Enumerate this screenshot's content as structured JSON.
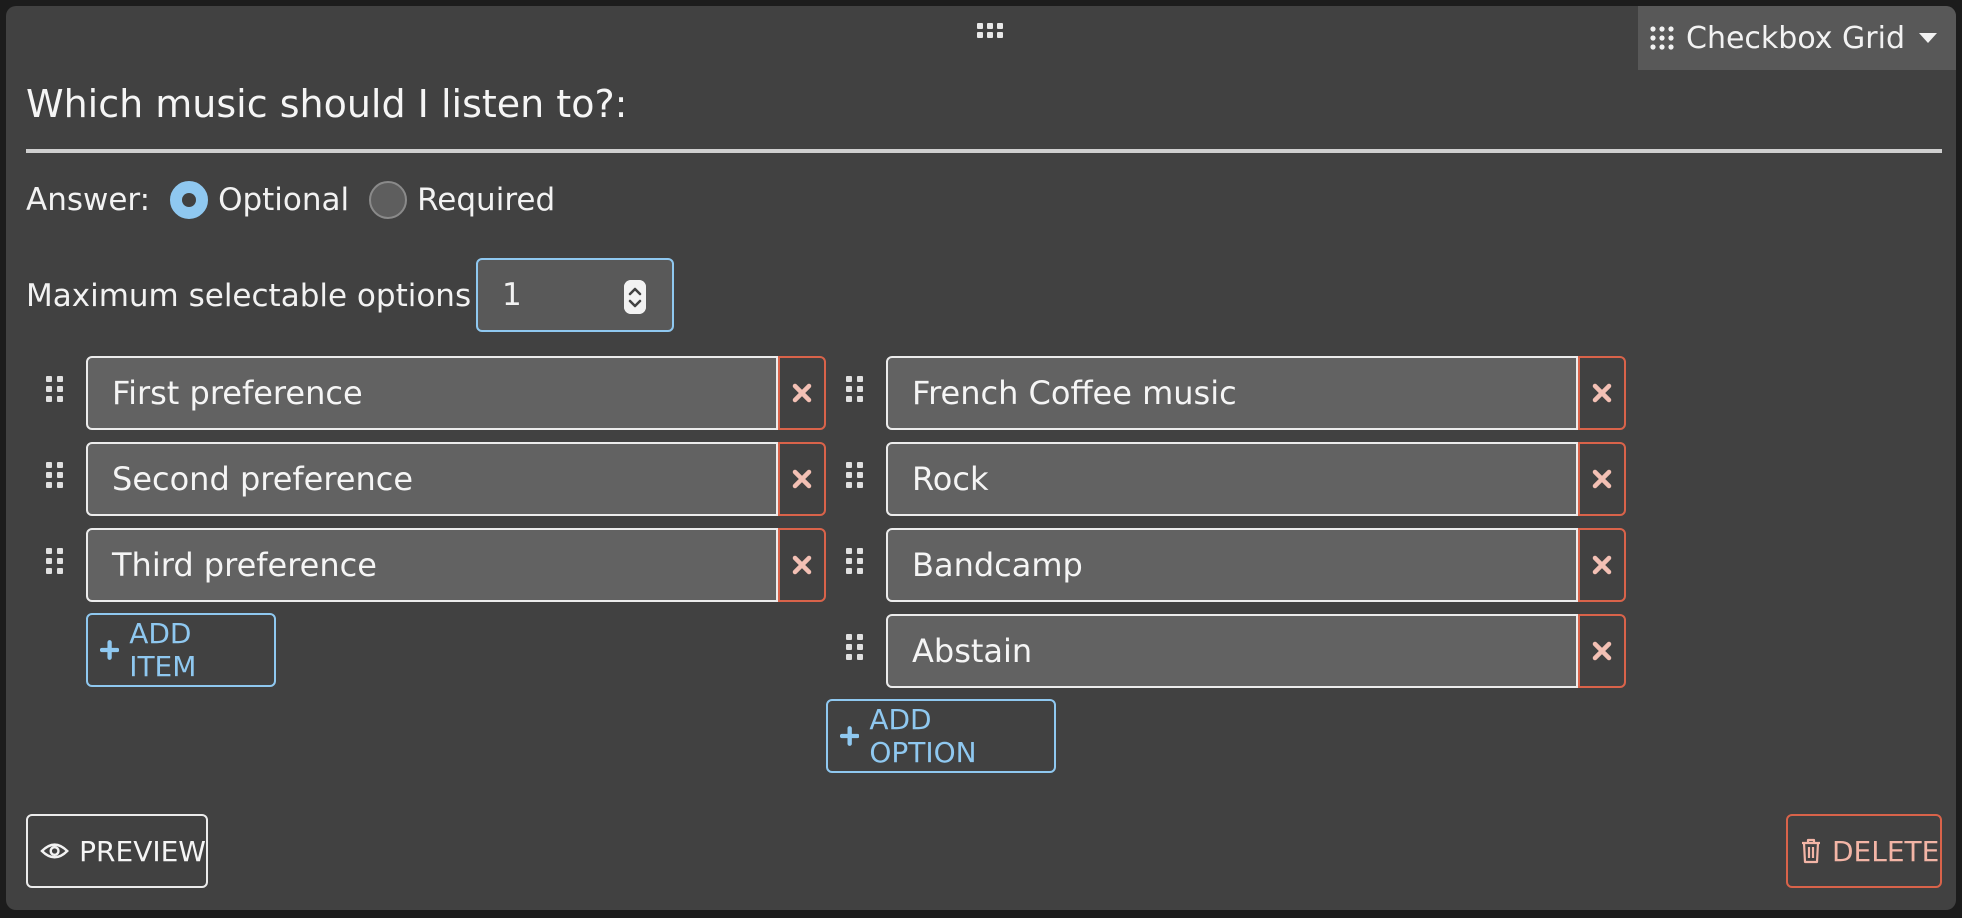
{
  "header": {
    "type_menu_label": "Checkbox Grid",
    "grid_icon": "grid-dots-icon",
    "caret_icon": "chevron-down-icon"
  },
  "question": {
    "title": "Which music should I listen to?:"
  },
  "answer": {
    "label": "Answer:",
    "options": [
      "Optional",
      "Required"
    ],
    "selected": "Optional"
  },
  "max_options": {
    "label": "Maximum selectable options",
    "value": "1"
  },
  "items": [
    {
      "label": "First preference"
    },
    {
      "label": "Second preference"
    },
    {
      "label": "Third preference"
    }
  ],
  "options": [
    {
      "label": "French Coffee music"
    },
    {
      "label": "Rock"
    },
    {
      "label": "Bandcamp"
    },
    {
      "label": "Abstain"
    }
  ],
  "buttons": {
    "add_item": "ADD ITEM",
    "add_option": "ADD OPTION",
    "preview": "PREVIEW",
    "delete": "DELETE"
  },
  "colors": {
    "background": "#414141",
    "accent_blue": "#8fc8f0",
    "danger_red": "#d9634a",
    "field_bg": "#626262"
  }
}
